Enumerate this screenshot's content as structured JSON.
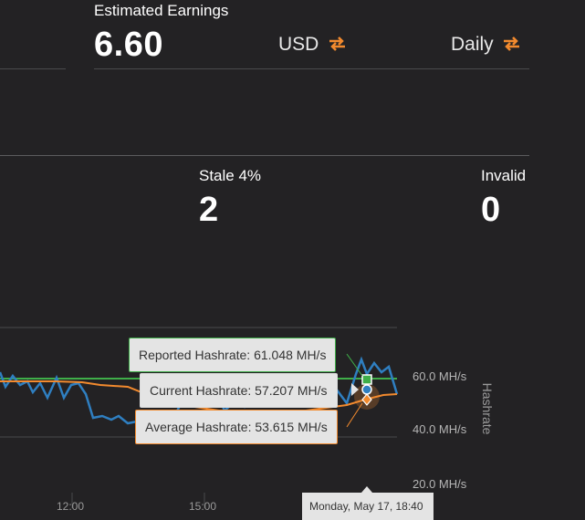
{
  "earnings": {
    "title": "Estimated Earnings",
    "value": "6.60",
    "currency": "USD",
    "period": "Daily"
  },
  "shares": {
    "stale_label": "Stale 4%",
    "stale_value": "2",
    "invalid_label": "Invalid",
    "invalid_value": "0"
  },
  "chart": {
    "y_axis_title": "Hashrate",
    "y_ticks": [
      "60.0 MH/s",
      "40.0 MH/s",
      "20.0 MH/s"
    ],
    "x_ticks": [
      "12:00",
      "15:00"
    ],
    "tooltip_date": "Monday, May 17, 18:40"
  },
  "tooltips": {
    "reported": "Reported Hashrate: 61.048 MH/s",
    "current": "Current Hashrate: 57.207 MH/s",
    "average": "Average Hashrate: 53.615 MH/s"
  },
  "chart_data": {
    "type": "line",
    "y_unit": "MH/s",
    "y_ticks": [
      60,
      40,
      20
    ],
    "series": [
      {
        "name": "Reported Hashrate",
        "values": [
          61.0,
          61.0,
          61.0,
          61.0,
          61.0,
          61.0,
          61.0,
          61.0,
          61.0,
          61.0,
          61.0,
          61.0,
          61.048
        ]
      },
      {
        "name": "Current Hashrate",
        "values": [
          62,
          57,
          60,
          55,
          59,
          58,
          56,
          61,
          59,
          45,
          46,
          42,
          65,
          57.207
        ]
      },
      {
        "name": "Average Hashrate",
        "values": [
          60,
          60,
          60,
          60,
          60,
          59,
          57,
          55,
          54,
          52.5,
          51,
          53,
          53.615
        ]
      }
    ],
    "colors": {
      "reported": "#3fae49",
      "current": "#2f7fc1",
      "average": "#f28a2e"
    }
  }
}
